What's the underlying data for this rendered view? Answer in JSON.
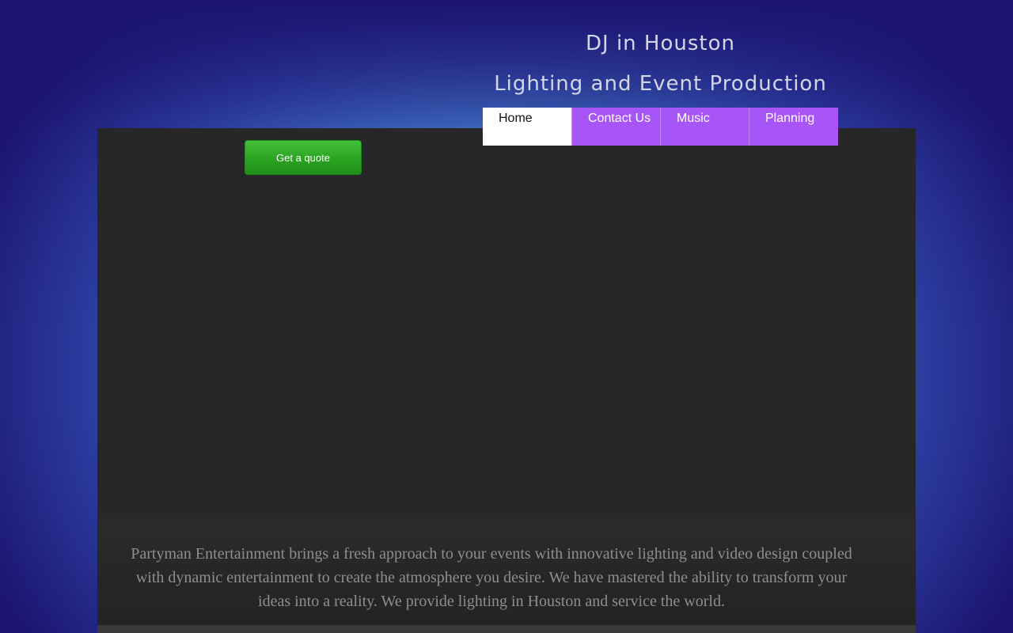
{
  "header": {
    "title": "DJ in Houston",
    "subtitle": "Lighting and Event Production"
  },
  "cta": {
    "quote_label": "Get a quote",
    "color": "#2ba322"
  },
  "nav": {
    "items": [
      {
        "label": "Home",
        "active": true
      },
      {
        "label": "Contact Us",
        "active": false
      },
      {
        "label": "Music",
        "active": false
      },
      {
        "label": "Planning",
        "active": false
      }
    ],
    "color": "#a855f7"
  },
  "main": {
    "intro": "Partyman Entertainment brings a fresh approach to your events with innovative lighting and video design coupled with dynamic entertainment to create the atmosphere you desire. We have mastered the ability to transform your ideas into a reality. We provide lighting in Houston and service the world."
  }
}
